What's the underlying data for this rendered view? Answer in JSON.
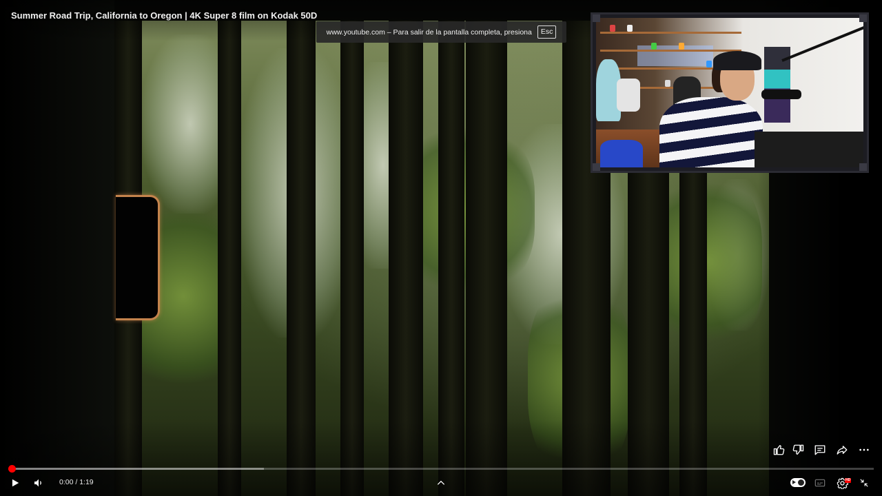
{
  "video": {
    "title": "Summer Road Trip, California to Oregon | 4K Super 8 film on Kodak 50D"
  },
  "fullscreen_notice": {
    "text": "www.youtube.com – Para salir de la pantalla completa, presiona",
    "key": "Esc"
  },
  "player": {
    "current_time": "0:00",
    "separator": " / ",
    "duration": "1:19",
    "played_fraction": 0.004,
    "buffered_fraction": 0.295,
    "quality_badge": "HD",
    "accent_color": "#ff0000"
  },
  "icons": {
    "play": "play-icon",
    "volume": "volume-icon",
    "chevron": "chevron-up-icon",
    "autoplay": "autoplay-toggle",
    "subtitles": "subtitles-icon",
    "settings": "gear-icon",
    "exit_fullscreen": "exit-fullscreen-icon",
    "like": "thumbs-up-icon",
    "dislike": "thumbs-down-icon",
    "comments": "comment-icon",
    "share": "share-icon",
    "more": "more-icon"
  }
}
